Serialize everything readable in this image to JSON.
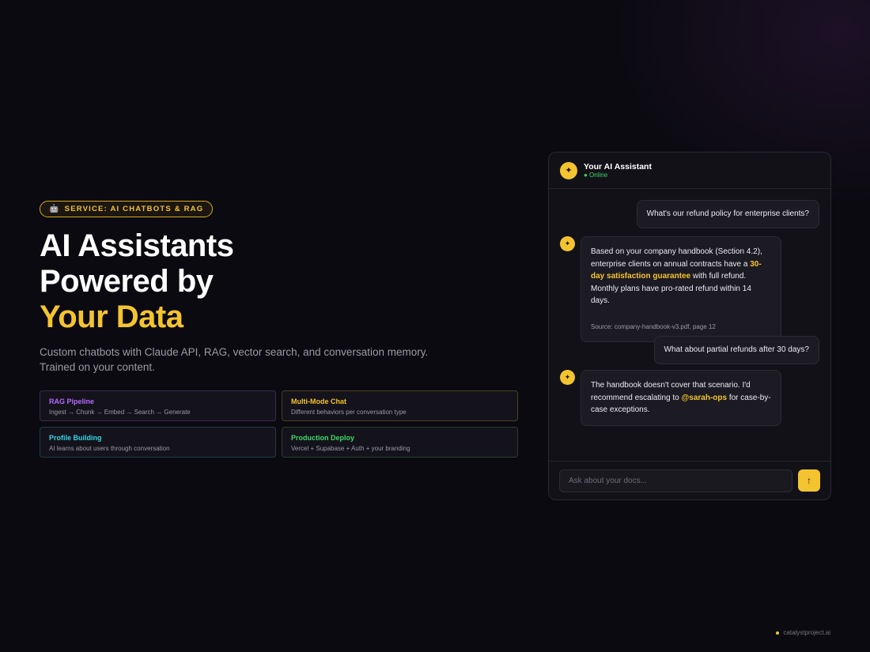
{
  "badge": {
    "icon": "robot-icon",
    "glyph": "🤖",
    "label": "SERVICE: AI CHATBOTS & RAG"
  },
  "headline": {
    "line1": "AI Assistants",
    "line2": "Powered by",
    "line3": "Your Data"
  },
  "subtitle": {
    "line1": "Custom chatbots with Claude API, RAG, vector search, and conversation memory.",
    "line2": "Trained on your content."
  },
  "features": [
    {
      "title": "RAG Pipeline",
      "desc": "Ingest → Chunk → Embed → Search → Generate",
      "color": "#b36bff"
    },
    {
      "title": "Multi-Mode Chat",
      "desc": "Different behaviors per conversation type",
      "color": "#f4c430"
    },
    {
      "title": "Profile Building",
      "desc": "AI learns about users through conversation",
      "color": "#34d3e6"
    },
    {
      "title": "Production Deploy",
      "desc": "Vercel + Supabase + Auth + your branding",
      "color": "#3fd96b"
    }
  ],
  "chat": {
    "assistant_name": "Your AI Assistant",
    "status": "● Online",
    "avatar_glyph": "✦",
    "messages": {
      "user1": "What's our refund policy for enterprise clients?",
      "bot1": {
        "pre": "Based on your company handbook (Section 4.2), enterprise clients on annual contracts have a ",
        "highlight": "30-day satisfaction guarantee",
        "post": " with full refund. Monthly plans have pro-rated refund within 14 days.",
        "source": "Source: company-handbook-v3.pdf, page 12"
      },
      "user2": "What about partial refunds after 30 days?",
      "bot2": {
        "pre": "The handbook doesn't cover that scenario. I'd recommend escalating to ",
        "mention": "@sarah-ops",
        "post": " for case-by-case exceptions."
      }
    },
    "input_placeholder": "Ask about your docs...",
    "input_value": "",
    "send_glyph": "↑"
  },
  "footer": {
    "domain": "catalystproject.ai"
  },
  "colors": {
    "accent": "#f4c430",
    "background": "#0b0a10",
    "online": "#3fd96b"
  }
}
